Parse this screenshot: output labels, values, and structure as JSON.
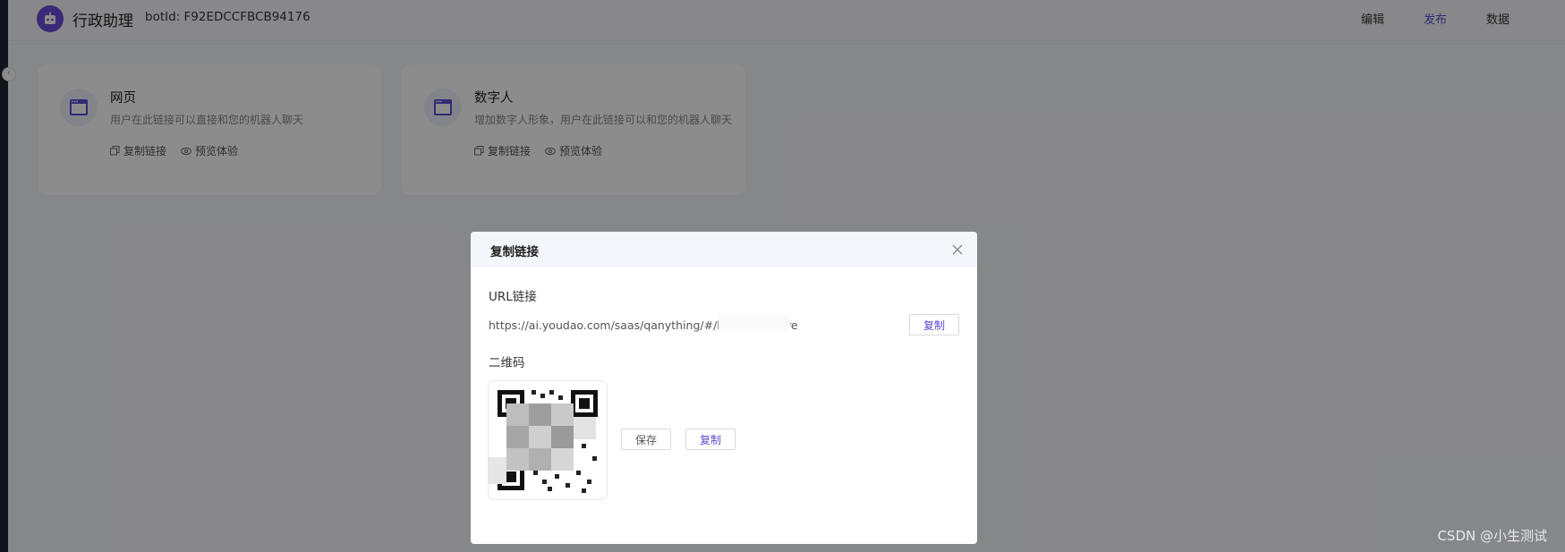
{
  "header": {
    "app_title": "行政助理",
    "bot_id_label": "botId: F92EDCCFBCB94176",
    "nav": [
      {
        "label": "编辑",
        "active": false
      },
      {
        "label": "发布",
        "active": true
      },
      {
        "label": "数据",
        "active": false
      }
    ]
  },
  "cards": [
    {
      "title": "网页",
      "desc": "用户在此链接可以直接和您的机器人聊天",
      "copy_link": "复制链接",
      "preview": "预览体验"
    },
    {
      "title": "数字人",
      "desc": "增加数字人形象，用户在此链接可以和您的机器人聊天",
      "copy_link": "复制链接",
      "preview": "预览体验"
    }
  ],
  "modal": {
    "title": "复制链接",
    "url_label": "URL链接",
    "url_value": "https://ai.youdao.com/saas/qanything/#/bo                          4176/share",
    "url_copy": "复制",
    "qr_label": "二维码",
    "qr_save": "保存",
    "qr_copy": "复制"
  },
  "watermark": "CSDN @小生测试",
  "colors": {
    "accent": "#5b4bd6",
    "overlay": "rgba(0,0,0,0.45)"
  }
}
